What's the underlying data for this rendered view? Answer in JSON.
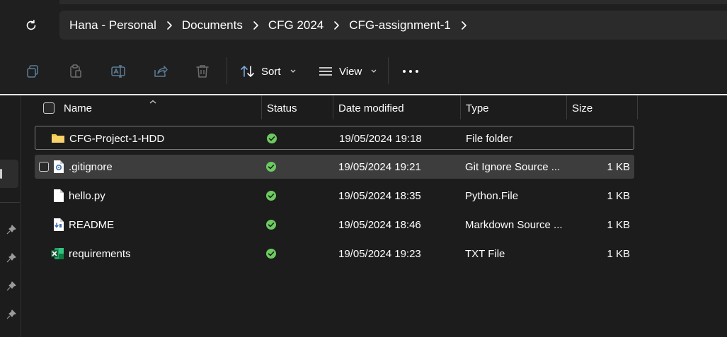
{
  "breadcrumb": {
    "items": [
      "Hana - Personal",
      "Documents",
      "CFG 2024",
      "CFG-assignment-1"
    ]
  },
  "toolbar": {
    "sort_label": "Sort",
    "view_label": "View"
  },
  "columns": {
    "name": "Name",
    "status": "Status",
    "date": "Date modified",
    "type": "Type",
    "size": "Size"
  },
  "files": [
    {
      "name": "CFG-Project-1-HDD",
      "date": "19/05/2024 19:18",
      "type": "File folder",
      "size": "",
      "icon": "folder-icon"
    },
    {
      "name": ".gitignore",
      "date": "19/05/2024 19:21",
      "type": "Git Ignore Source ...",
      "size": "1 KB",
      "icon": "gear-file-icon"
    },
    {
      "name": "hello.py",
      "date": "19/05/2024 18:35",
      "type": "Python.File",
      "size": "1 KB",
      "icon": "blank-file-icon"
    },
    {
      "name": "README",
      "date": "19/05/2024 18:46",
      "type": "Markdown Source ...",
      "size": "1 KB",
      "icon": "markdown-file-icon"
    },
    {
      "name": "requirements",
      "date": "19/05/2024 19:23",
      "type": "TXT File",
      "size": "1 KB",
      "icon": "excel-file-icon"
    }
  ],
  "colors": {
    "status_synced": "#6ccb5f",
    "folder": "#f3c74b",
    "excel": "#1f7a45"
  }
}
